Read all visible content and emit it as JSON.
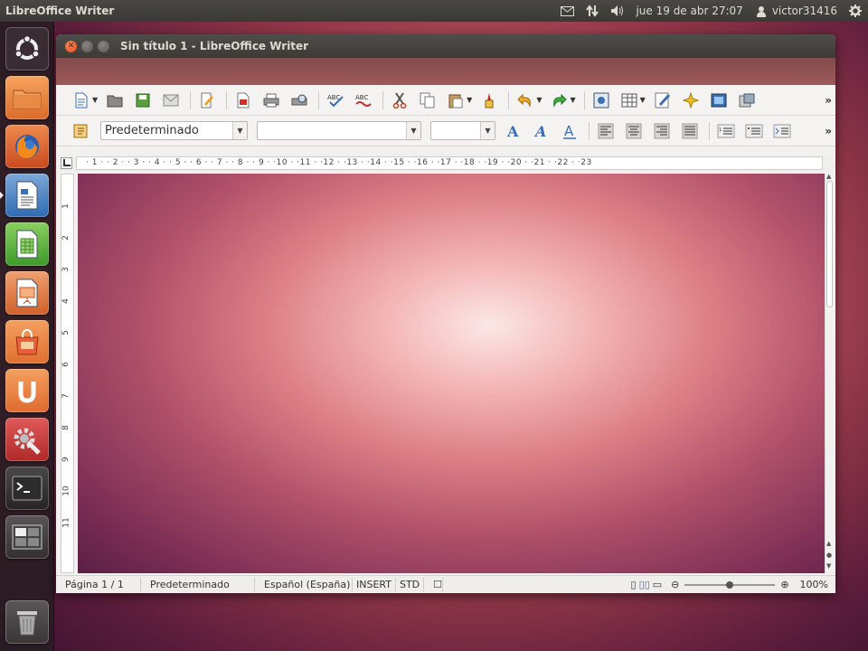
{
  "top_panel": {
    "app_name": "LibreOffice Writer",
    "datetime": "jue 19 de abr 27:07",
    "username": "victor31416",
    "icons": [
      "mail-icon",
      "network-icon",
      "volume-icon",
      "user-icon",
      "settings-gear-icon"
    ]
  },
  "launcher": {
    "items": [
      {
        "name": "dash-home",
        "icon": "ubuntu-logo-icon"
      },
      {
        "name": "home-folder",
        "icon": "folder-icon"
      },
      {
        "name": "firefox",
        "icon": "firefox-icon"
      },
      {
        "name": "libreoffice-writer",
        "icon": "writer-icon",
        "active": true
      },
      {
        "name": "libreoffice-calc",
        "icon": "calc-icon"
      },
      {
        "name": "libreoffice-impress",
        "icon": "impress-icon"
      },
      {
        "name": "software-center",
        "icon": "shopping-bag-icon"
      },
      {
        "name": "ubuntu-one",
        "icon": "ubuntu-one-icon"
      },
      {
        "name": "system-settings",
        "icon": "wrench-gear-icon"
      },
      {
        "name": "terminal",
        "icon": "terminal-icon"
      },
      {
        "name": "workspace-switcher",
        "icon": "workspace-icon"
      },
      {
        "name": "trash",
        "icon": "trash-icon"
      }
    ]
  },
  "window": {
    "title": "Sin título 1 - LibreOffice Writer"
  },
  "formatting": {
    "paragraph_style": "Predeterminado",
    "font_name": "",
    "font_size": ""
  },
  "ruler": {
    "h_marks": "· 1 · · 2 · · 3 · · 4 · · 5 · · 6 · · 7 · · 8 · · 9 · ·10 · ·11 · ·12 · ·13 · ·14 · ·15 · ·16 · ·17 · ·18 · ·19 · ·20 · ·21 · ·22 · ·23",
    "v_marks": [
      "1",
      "2",
      "3",
      "4",
      "5",
      "6",
      "7",
      "8",
      "9",
      "10",
      "11"
    ]
  },
  "status": {
    "page": "Página  1 / 1",
    "style": "Predeterminado",
    "language": "Español (España)",
    "mode": "INSERT",
    "selection": "STD",
    "zoom": "100%",
    "zoom_fraction": 0.5
  },
  "colors": {
    "panel": "#3c3b37",
    "close_button": "#de4a15",
    "launcher_active": "#eeeeee"
  }
}
